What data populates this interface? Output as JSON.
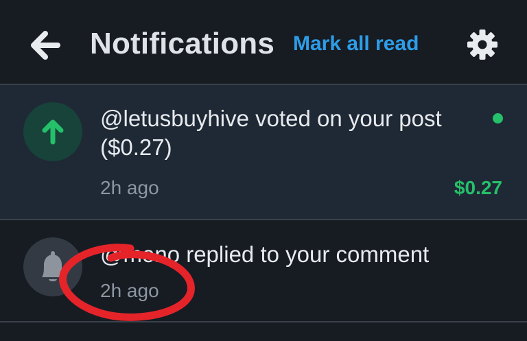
{
  "header": {
    "back_icon": "arrow-left-icon",
    "title": "Notifications",
    "mark_all_read_label": "Mark all read",
    "settings_icon": "gear-icon"
  },
  "notifications": [
    {
      "icon": "arrow-up-icon",
      "message": "@letusbuyhive voted on your post ($0.27)",
      "time": "2h ago",
      "amount": "$0.27",
      "unread": true
    },
    {
      "icon": "bell-icon",
      "message": "@meno replied to your comment",
      "time": "2h ago",
      "unread": false
    }
  ],
  "colors": {
    "background": "#171c23",
    "unread_row": "#1f2935",
    "accent_blue": "#2d9de8",
    "accent_green": "#25c06a",
    "annotation_red": "#e5242a"
  }
}
